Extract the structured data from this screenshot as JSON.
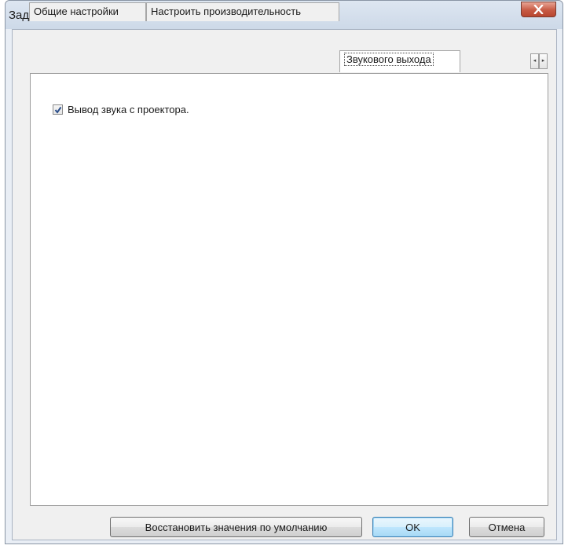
{
  "window": {
    "title": "Задать значения опций",
    "close_label": "X"
  },
  "tabs": [
    {
      "label": "Общие настройки",
      "active": false
    },
    {
      "label": "Настроить производительность",
      "active": false
    },
    {
      "label": "Звукового выхода",
      "active": true
    }
  ],
  "tab_scroll": {
    "left_arrow": "◂",
    "right_arrow": "▸"
  },
  "panel": {
    "checkbox": {
      "label": "Вывод звука с проектора.",
      "checked": true
    }
  },
  "buttons": {
    "restore_defaults": "Восстановить значения по умолчанию",
    "ok": "OK",
    "cancel": "Отмена"
  },
  "colors": {
    "checkmark": "#2a4d8a",
    "close_button": "#c75a44",
    "default_button_border": "#3c7fb1"
  }
}
